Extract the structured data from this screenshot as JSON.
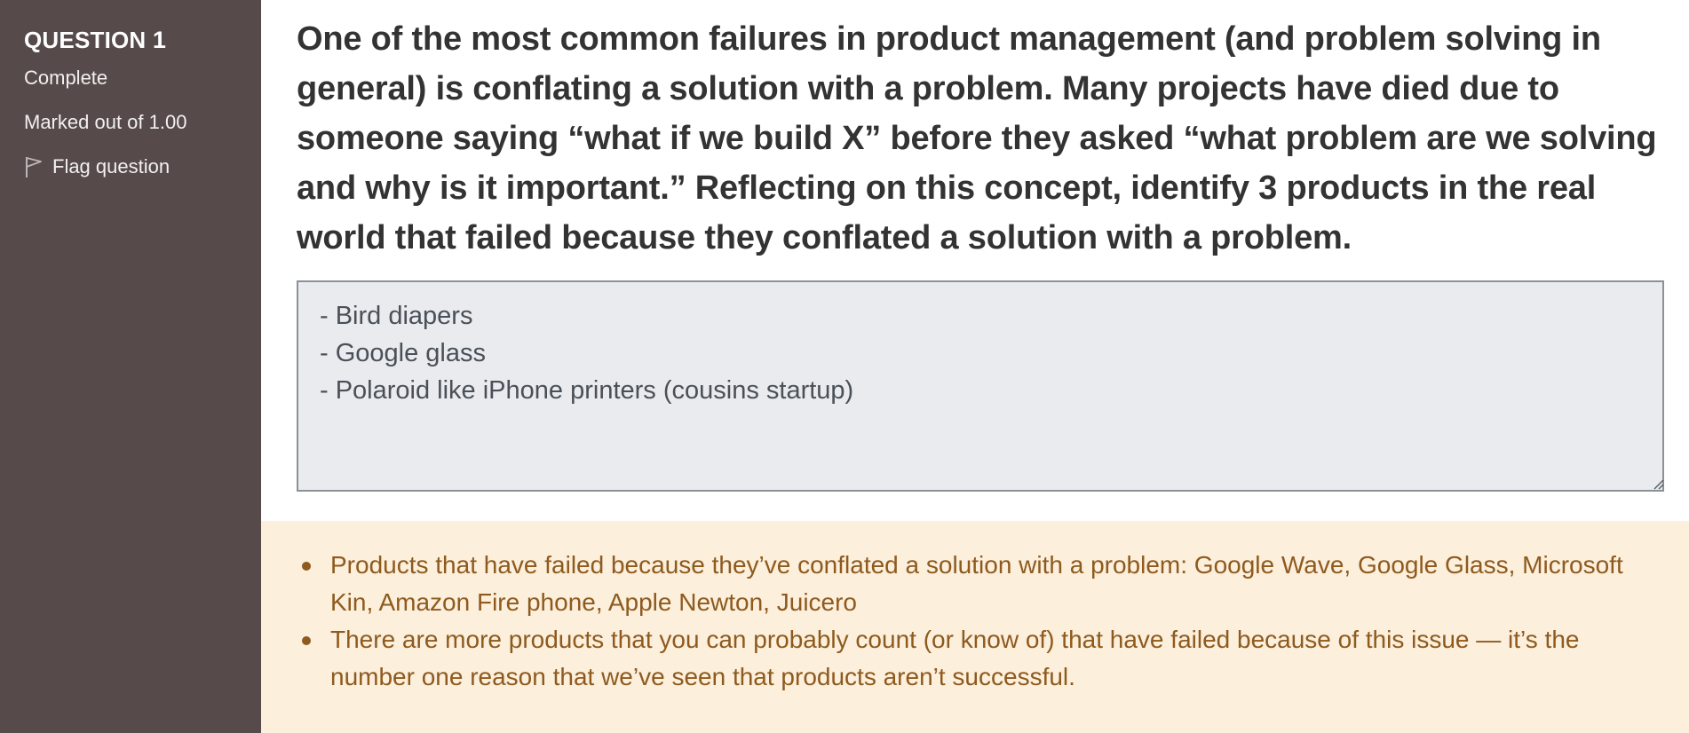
{
  "sidebar": {
    "question_label": "QUESTION",
    "question_number": "1",
    "status": "Complete",
    "marks": "Marked out of 1.00",
    "flag_label": "Flag question"
  },
  "question": {
    "text": "One of the most common failures in product management (and problem solving in general) is conflating a solution with a problem. Many projects have died due to someone saying “what if we build X” before they asked “what problem are we solving and why is it important.” Reflecting on this concept, identify 3 products in the real world that failed because they conflated a solution with a problem."
  },
  "answer": {
    "value": "- Bird diapers\n- Google glass\n- Polaroid like iPhone printers (cousins startup)"
  },
  "feedback": {
    "items": [
      "Products that have failed because they’ve conflated a solution with a problem: Google Wave, Google Glass, Microsoft Kin, Amazon Fire phone, Apple Newton, Juicero",
      "There are more products that you can probably count (or know of) that have failed because of this issue — it’s the number one reason that we’ve seen that products aren’t successful."
    ]
  },
  "colors": {
    "sidebar_bg": "#564a4a",
    "feedback_bg": "#fcefdc",
    "feedback_text": "#8e5a1e",
    "answer_bg": "#e9ebef"
  },
  "icons": {
    "flag": "flag-outline-icon",
    "resize": "resize-grip-icon"
  }
}
